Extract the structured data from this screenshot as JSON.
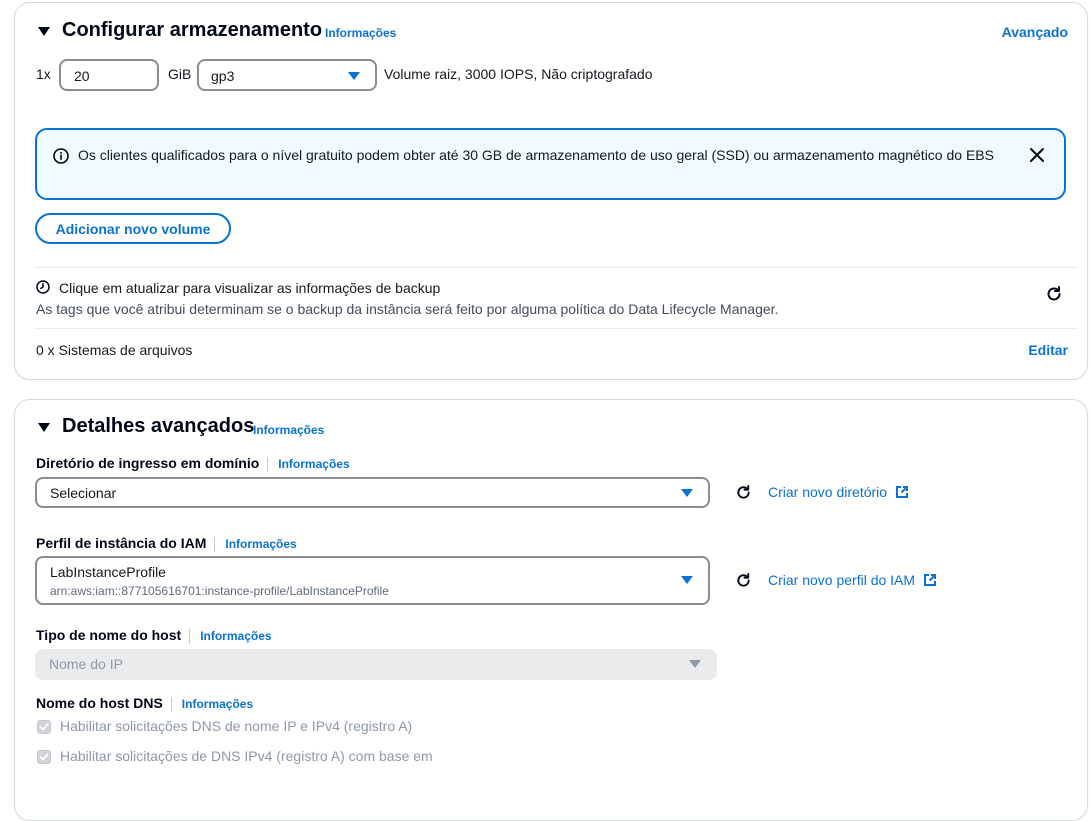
{
  "storage": {
    "title": "Configurar armazenamento",
    "info": "Informações",
    "advanced": "Avançado",
    "multiplier": "1x",
    "size_value": "20",
    "unit": "GiB",
    "volume_type": "gp3",
    "volume_summary": "Volume raiz,  3000 IOPS,  Não criptografado",
    "alert_text": "Os clientes qualificados para o nível gratuito podem obter até 30 GB de armazenamento de uso geral (SSD) ou armazenamento magnético do EBS",
    "add_volume": "Adicionar novo volume",
    "backup_title": "Clique em atualizar para visualizar as informações de backup",
    "backup_desc": "As tags que você atribui determinam se o backup da instância será feito por alguma política do Data Lifecycle Manager.",
    "filesystems": "0 x Sistemas de arquivos",
    "edit": "Editar"
  },
  "advanced": {
    "title": "Detalhes avançados",
    "info": "Informações",
    "domain_dir": {
      "label": "Diretório de ingresso em domínio",
      "info": "Informações",
      "value": "Selecionar",
      "create_link": "Criar novo diretório"
    },
    "iam": {
      "label": "Perfil de instância do IAM",
      "info": "Informações",
      "value": "LabInstanceProfile",
      "arn": "arn:aws:iam::877105616701:instance-profile/LabInstanceProfile",
      "create_link": "Criar novo perfil do IAM"
    },
    "hostname_type": {
      "label": "Tipo de nome do host",
      "info": "Informações",
      "placeholder": "Nome do IP"
    },
    "dns_hostname": {
      "label": "Nome do host DNS",
      "info": "Informações",
      "option1": "Habilitar solicitações DNS de nome IP e IPv4 (registro A)",
      "option2": "Habilitar solicitações de DNS IPv4 (registro A) com base em"
    }
  },
  "colors": {
    "link": "#0972d3",
    "alert_bg": "#f0fbff",
    "alert_border": "#0972d3",
    "disabled": "#8d99a8"
  }
}
